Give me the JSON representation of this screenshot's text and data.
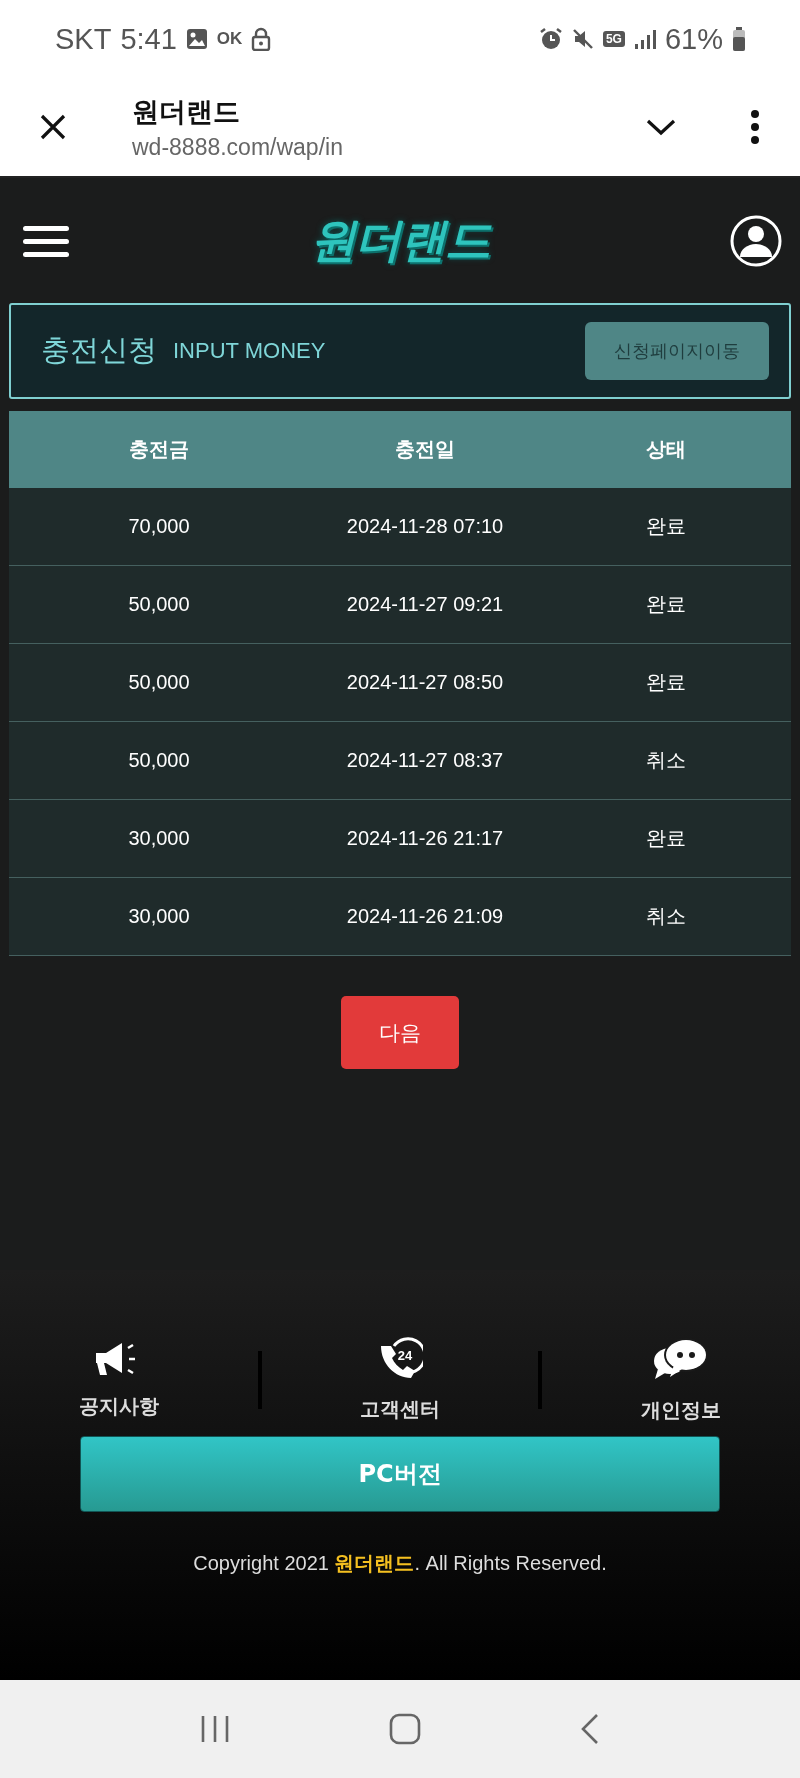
{
  "status_bar": {
    "carrier": "SKT",
    "time": "5:41",
    "ok_label": "OK",
    "network": "5G",
    "battery": "61%"
  },
  "browser": {
    "title": "원더랜드",
    "url": "wd-8888.com/wap/in"
  },
  "header": {
    "logo": "원더랜드"
  },
  "panel": {
    "title": "충전신청",
    "subtitle": "INPUT MONEY",
    "button": "신청페이지이동"
  },
  "table": {
    "columns": [
      "충전금",
      "충전일",
      "상태"
    ],
    "rows": [
      {
        "amount": "70,000",
        "date": "2024-11-28 07:10",
        "status": "완료"
      },
      {
        "amount": "50,000",
        "date": "2024-11-27 09:21",
        "status": "완료"
      },
      {
        "amount": "50,000",
        "date": "2024-11-27 08:50",
        "status": "완료"
      },
      {
        "amount": "50,000",
        "date": "2024-11-27 08:37",
        "status": "취소"
      },
      {
        "amount": "30,000",
        "date": "2024-11-26 21:17",
        "status": "완료"
      },
      {
        "amount": "30,000",
        "date": "2024-11-26 21:09",
        "status": "취소"
      }
    ]
  },
  "next_button": "다음",
  "footer": {
    "links": [
      {
        "kind": "notice",
        "label": "공지사항"
      },
      {
        "kind": "support",
        "label": "고객센터",
        "badge": "24"
      },
      {
        "kind": "privacy",
        "label": "개인정보"
      }
    ],
    "pc_button": "PC버전",
    "copyright": "Copyright 2021 **원더랜드**. All Rights Reserved."
  }
}
